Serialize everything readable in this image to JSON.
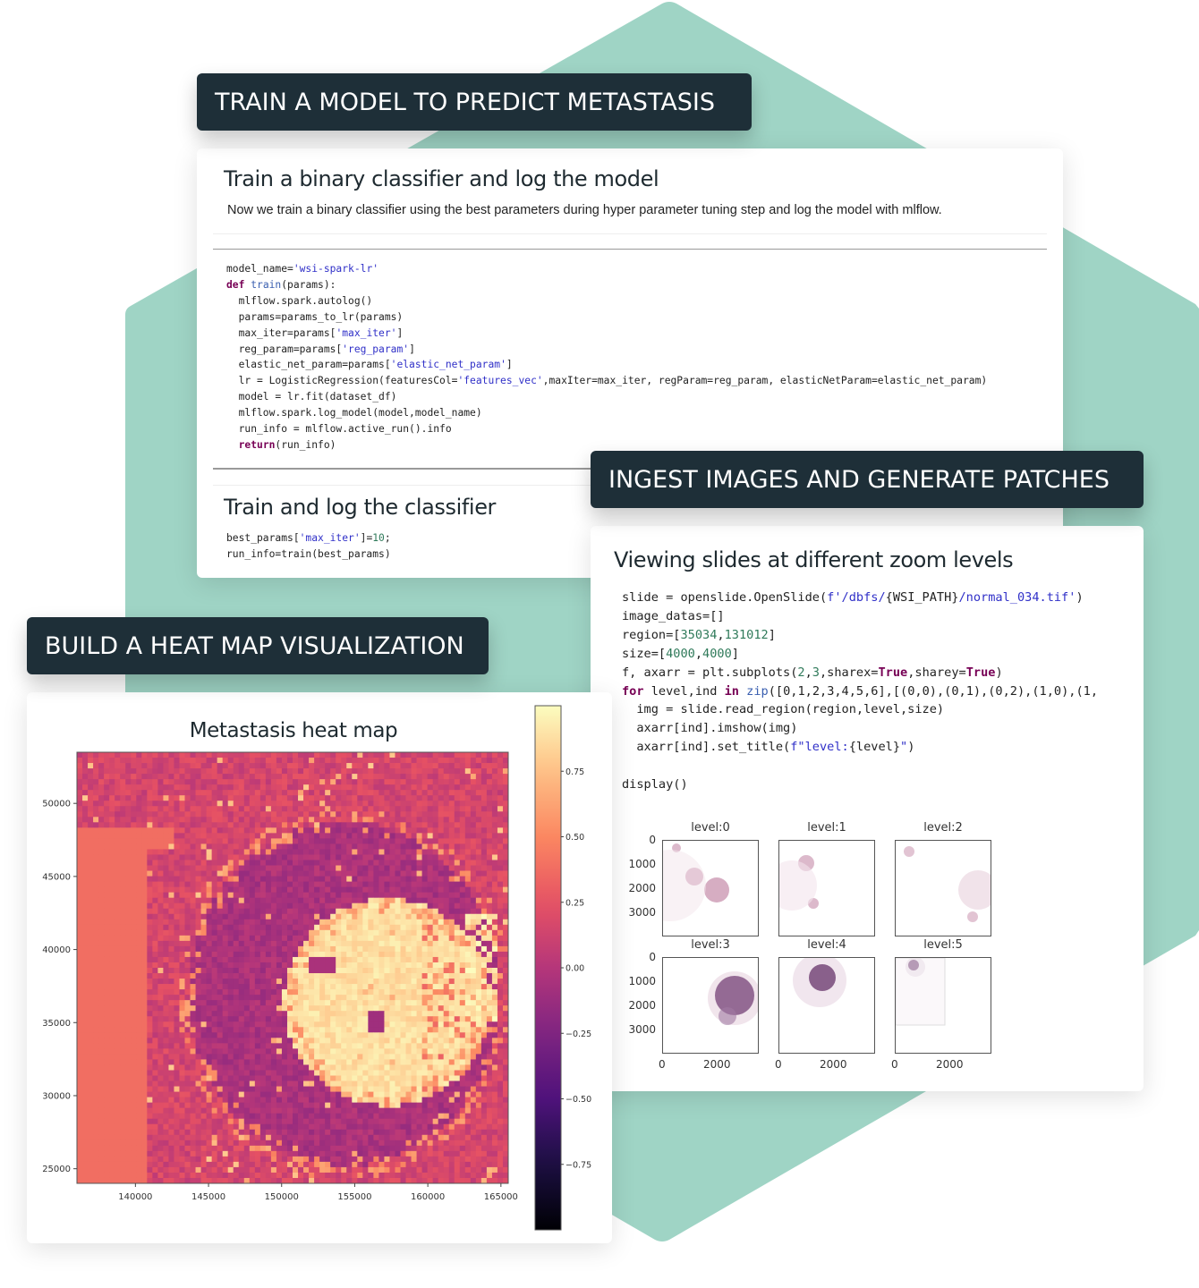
{
  "colors": {
    "background": "#ffffff",
    "hexagon": "#9fd4c5",
    "label_bg": "#1e2f38",
    "label_text": "#ffffff",
    "code_keyword": "#770055",
    "code_string": "#3030c8",
    "code_function": "#3a5fb0",
    "code_number": "#2f7a5a"
  },
  "labels": {
    "train_model": "TRAIN A MODEL TO PREDICT METASTASIS",
    "ingest_images": "INGEST IMAGES AND GENERATE PATCHES",
    "heat_map": "BUILD A HEAT MAP VISUALIZATION"
  },
  "train_card": {
    "heading": "Train a binary classifier and log the model",
    "description": "Now we train a binary classifier using the best parameters during hyper parameter tuning step and log the model with mlflow.",
    "code_lines": [
      [
        [
          "",
          "model_name="
        ],
        [
          "str",
          "'wsi-spark-lr'"
        ]
      ],
      [
        [
          "kw",
          "def"
        ],
        [
          "",
          " "
        ],
        [
          "fn",
          "train"
        ],
        [
          "",
          "(params):"
        ]
      ],
      [
        [
          "",
          "  mlflow.spark.autolog()"
        ]
      ],
      [
        [
          "",
          "  params=params_to_lr(params)"
        ]
      ],
      [
        [
          "",
          "  max_iter=params["
        ],
        [
          "str",
          "'max_iter'"
        ],
        [
          "",
          "]"
        ]
      ],
      [
        [
          "",
          "  reg_param=params["
        ],
        [
          "str",
          "'reg_param'"
        ],
        [
          "",
          "]"
        ]
      ],
      [
        [
          "",
          "  elastic_net_param=params["
        ],
        [
          "str",
          "'elastic_net_param'"
        ],
        [
          "",
          "]"
        ]
      ],
      [
        [
          "",
          "  lr = LogisticRegression(featuresCol="
        ],
        [
          "str",
          "'features_vec'"
        ],
        [
          "",
          ",maxIter=max_iter, regParam=reg_param, elasticNetParam=elastic_net_param)"
        ]
      ],
      [
        [
          "",
          "  model = lr.fit(dataset_df)"
        ]
      ],
      [
        [
          "",
          "  mlflow.spark.log_model(model,model_name)"
        ]
      ],
      [
        [
          "",
          "  run_info = mlflow.active_run().info"
        ]
      ],
      [
        [
          "",
          "  "
        ],
        [
          "kw",
          "return"
        ],
        [
          "",
          "(run_info)"
        ]
      ]
    ],
    "heading2": "Train and log the classifier",
    "code2_lines": [
      [
        [
          "",
          "best_params["
        ],
        [
          "str",
          "'max_iter'"
        ],
        [
          "",
          "]="
        ],
        [
          "num",
          "10"
        ],
        [
          "",
          ";"
        ]
      ],
      [
        [
          "",
          "run_info=train(best_params)"
        ]
      ]
    ]
  },
  "ingest_card": {
    "heading": "Viewing slides at different zoom levels",
    "code_lines": [
      [
        [
          "",
          "slide = openslide.OpenSlide("
        ],
        [
          "str",
          "f'/dbfs/"
        ],
        [
          "",
          "{WSI_PATH}"
        ],
        [
          "str",
          "/normal_034.tif'"
        ],
        [
          "",
          ")"
        ]
      ],
      [
        [
          "",
          "image_datas=[]"
        ]
      ],
      [
        [
          "",
          "region=["
        ],
        [
          "num",
          "35034"
        ],
        [
          "",
          ","
        ],
        [
          "num",
          "131012"
        ],
        [
          "",
          "]"
        ]
      ],
      [
        [
          "",
          "size=["
        ],
        [
          "num",
          "4000"
        ],
        [
          "",
          ","
        ],
        [
          "num",
          "4000"
        ],
        [
          "",
          "]"
        ]
      ],
      [
        [
          "",
          "f, axarr = plt.subplots("
        ],
        [
          "num",
          "2"
        ],
        [
          "",
          ","
        ],
        [
          "num",
          "3"
        ],
        [
          "",
          ",sharex="
        ],
        [
          "bool",
          "True"
        ],
        [
          "",
          ",sharey="
        ],
        [
          "bool",
          "True"
        ],
        [
          "",
          ")"
        ]
      ],
      [
        [
          "kw",
          "for"
        ],
        [
          "",
          " level,ind "
        ],
        [
          "kw",
          "in"
        ],
        [
          "",
          " "
        ],
        [
          "fn",
          "zip"
        ],
        [
          "",
          "([0,1,2,3,4,5,6],[(0,0),(0,1),(0,2),(1,0),(1,"
        ]
      ],
      [
        [
          "",
          "  img = slide.read_region(region,level,size)"
        ]
      ],
      [
        [
          "",
          "  axarr[ind].imshow(img)"
        ]
      ],
      [
        [
          "",
          "  axarr[ind].set_title("
        ],
        [
          "str",
          "f\"level:"
        ],
        [
          "",
          "{level}"
        ],
        [
          "str",
          "\""
        ],
        [
          "",
          ")"
        ]
      ],
      [
        [
          "",
          ""
        ]
      ],
      [
        [
          "",
          "display()"
        ]
      ]
    ],
    "subplots": [
      {
        "title": "level:0"
      },
      {
        "title": "level:1"
      },
      {
        "title": "level:2"
      },
      {
        "title": "level:3"
      },
      {
        "title": "level:4"
      },
      {
        "title": "level:5"
      }
    ],
    "y_ticks": [
      "0",
      "1000",
      "2000",
      "3000"
    ],
    "x_ticks": [
      "0",
      "2000"
    ]
  },
  "chart_data": {
    "type": "heatmap",
    "title": "Metastasis heat map",
    "xlabel": "",
    "ylabel": "",
    "xlim": [
      136000,
      165500
    ],
    "ylim": [
      24000,
      53500
    ],
    "x_ticks": [
      140000,
      145000,
      150000,
      155000,
      160000,
      165000
    ],
    "x_tick_labels": [
      "140000",
      "145000",
      "150000",
      "155000",
      "160000",
      "165000"
    ],
    "y_ticks": [
      50000,
      45000,
      40000,
      35000,
      30000,
      25000
    ],
    "y_tick_labels": [
      "50000",
      "45000",
      "40000",
      "35000",
      "30000",
      "25000"
    ],
    "colorbar": {
      "range": [
        -1.0,
        1.0
      ],
      "ticks": [
        0.75,
        0.5,
        0.25,
        0.0,
        -0.25,
        -0.5,
        -0.75
      ],
      "tick_labels": [
        "0.75",
        "0.50",
        "0.25",
        "0.00",
        "−0.25",
        "−0.50",
        "−0.75"
      ],
      "colormap": "magma"
    },
    "regions": [
      {
        "name": "background-tissue",
        "approx_value": 0.15
      },
      {
        "name": "ring-low",
        "approx_value": -0.05
      },
      {
        "name": "flat-block-left",
        "approx_value": 0.38
      },
      {
        "name": "tumor-core",
        "approx_value": 0.95
      }
    ],
    "grid": false
  }
}
